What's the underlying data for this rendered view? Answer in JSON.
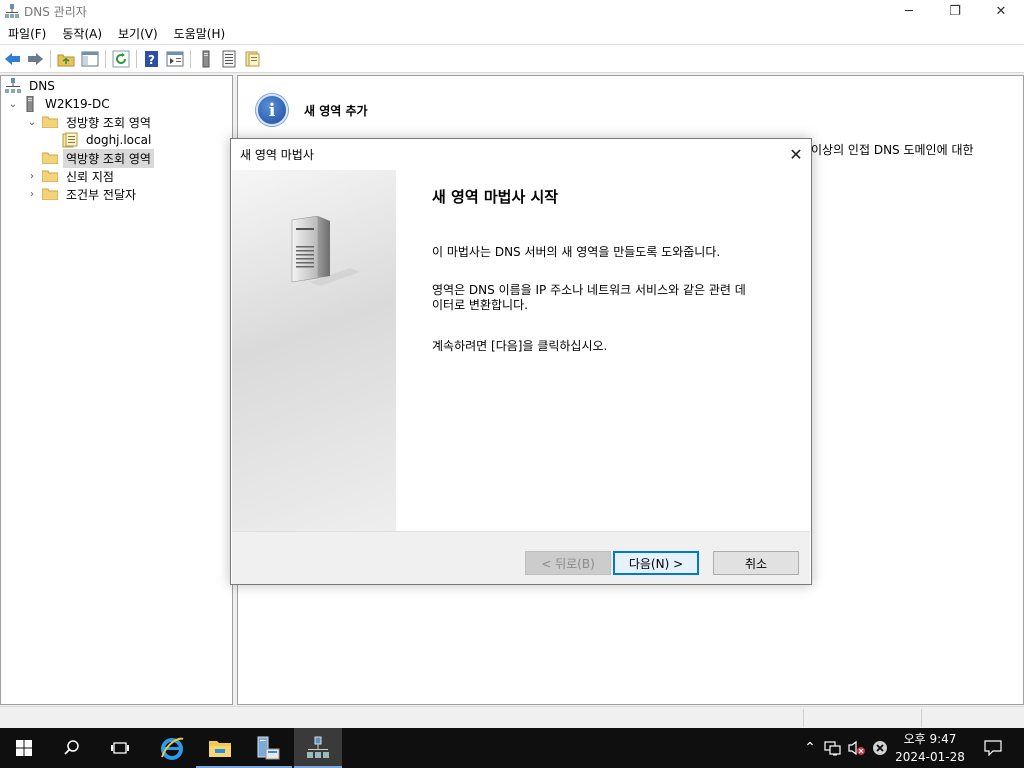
{
  "window": {
    "title": "DNS 관리자"
  },
  "window_controls": {
    "minimize": "─",
    "maximize": "❐",
    "close": "✕"
  },
  "menu": [
    "파일(F)",
    "동작(A)",
    "보기(V)",
    "도움말(H)"
  ],
  "tree": {
    "root": "DNS",
    "server": "W2K19-DC",
    "forward_zones": "정방향 조회 영역",
    "zone": "doghj.local",
    "reverse_zones": "역방향 조회 영역",
    "trust_points": "신뢰 지점",
    "conditional_forwarders": "조건부 전달자"
  },
  "right_pane": {
    "heading": "새 영역 추가",
    "text_fragment": "이상의 인접 DNS 도메인에 대한"
  },
  "dialog": {
    "title": "새 영역 마법사",
    "close": "✕",
    "heading": "새 영역 마법사 시작",
    "p1": "이 마법사는 DNS 서버의 새 영역을 만들도록 도와줍니다.",
    "p2_line1": "영역은 DNS 이름을 IP 주소나 네트워크 서비스와 같은 관련 데",
    "p2_line2": "이터로 변환합니다.",
    "p3": "계속하려면 [다음]을 클릭하십시오.",
    "back_button": "< 뒤로(B)",
    "next_button": "다음(N) >",
    "cancel_button": "취소"
  },
  "taskbar": {
    "clock_time": "오후 9:47",
    "clock_date": "2024-01-28"
  },
  "colors": {
    "accent": "#0078d7",
    "taskbar": "#0f0f0f"
  }
}
